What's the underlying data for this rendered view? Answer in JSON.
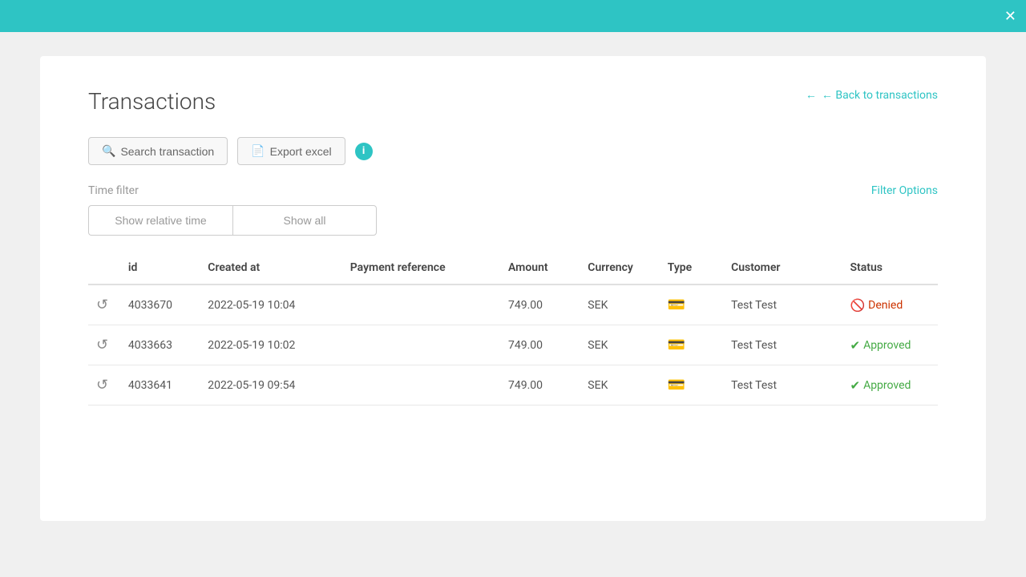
{
  "topbar": {
    "close_icon": "✕"
  },
  "header": {
    "title": "Transactions",
    "back_link": "← Back to transactions"
  },
  "toolbar": {
    "search_label": "Search transaction",
    "export_label": "Export excel",
    "info_icon": "i"
  },
  "time_filter": {
    "label": "Time filter",
    "show_relative_label": "Show relative time",
    "show_all_label": "Show all",
    "filter_options_label": "Filter Options"
  },
  "table": {
    "columns": [
      "id",
      "Created at",
      "Payment reference",
      "Amount",
      "Currency",
      "Type",
      "Customer",
      "Status"
    ],
    "rows": [
      {
        "id": "4033670",
        "created_at": "2022-05-19 10:04",
        "payment_reference": "",
        "amount": "749.00",
        "currency": "SEK",
        "type_icon": "card",
        "customer": "Test Test",
        "status": "Denied",
        "status_type": "denied"
      },
      {
        "id": "4033663",
        "created_at": "2022-05-19 10:02",
        "payment_reference": "",
        "amount": "749.00",
        "currency": "SEK",
        "type_icon": "card",
        "customer": "Test Test",
        "status": "Approved",
        "status_type": "approved"
      },
      {
        "id": "4033641",
        "created_at": "2022-05-19 09:54",
        "payment_reference": "",
        "amount": "749.00",
        "currency": "SEK",
        "type_icon": "card",
        "customer": "Test Test",
        "status": "Approved",
        "status_type": "approved"
      }
    ]
  }
}
